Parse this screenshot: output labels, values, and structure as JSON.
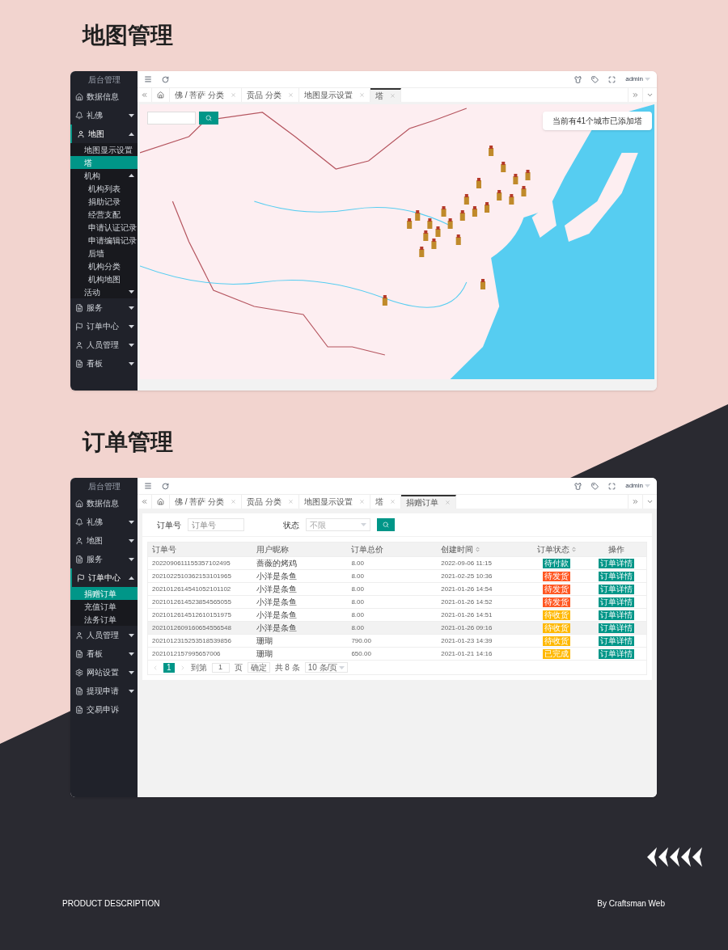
{
  "sections": [
    {
      "heading": "地图管理",
      "kind": "map",
      "window": {
        "brand": "后台管理",
        "user": "admin",
        "sidebar": [
          {
            "label": "数据信息"
          },
          {
            "label": "礼佛",
            "expanded": false
          },
          {
            "label": "地图",
            "expanded": true,
            "children": [
              {
                "label": "地图显示设置",
                "selected": false
              },
              {
                "label": "塔",
                "selected": true
              },
              {
                "label": "机构",
                "selected": false,
                "expanded": true,
                "children": [
                  {
                    "label": "机构列表",
                    "selected": false
                  },
                  {
                    "label": "捐助记录",
                    "selected": false
                  },
                  {
                    "label": "经营支配",
                    "selected": false
                  },
                  {
                    "label": "申请认证记录",
                    "selected": false
                  },
                  {
                    "label": "申请编辑记录",
                    "selected": false
                  },
                  {
                    "label": "后墙",
                    "selected": false
                  },
                  {
                    "label": "机构分类",
                    "selected": false
                  },
                  {
                    "label": "机构地图",
                    "selected": false
                  }
                ]
              },
              {
                "label": "活动",
                "selected": false,
                "expanded": false
              }
            ]
          },
          {
            "label": "服务",
            "expanded": false
          },
          {
            "label": "订单中心",
            "expanded": false
          },
          {
            "label": "人员管理",
            "expanded": false
          },
          {
            "label": "看板",
            "expanded": false
          }
        ],
        "tabs": [
          {
            "label": "佛 / 菩萨 分类",
            "selected": false
          },
          {
            "label": "贡品 分类",
            "selected": false
          },
          {
            "label": "地图显示设置",
            "selected": false
          },
          {
            "label": "塔",
            "selected": true
          }
        ]
      },
      "map_notice": "当前有41个城市已添加塔"
    },
    {
      "heading": "订单管理",
      "kind": "orders",
      "window": {
        "brand": "后台管理",
        "user": "admin",
        "sidebar": [
          {
            "label": "数据信息"
          },
          {
            "label": "礼佛",
            "expanded": false
          },
          {
            "label": "地图",
            "expanded": false
          },
          {
            "label": "服务",
            "expanded": false
          },
          {
            "label": "订单中心",
            "expanded": true,
            "children": [
              {
                "label": "捐赠订单",
                "selected": true
              },
              {
                "label": "充值订单",
                "selected": false
              },
              {
                "label": "法务订单",
                "selected": false
              }
            ]
          },
          {
            "label": "人员管理",
            "expanded": false
          },
          {
            "label": "看板",
            "expanded": false
          },
          {
            "label": "网站设置",
            "expanded": false
          },
          {
            "label": "提现申请",
            "expanded": false
          },
          {
            "label": "交易申诉"
          }
        ],
        "tabs": [
          {
            "label": "佛 / 菩萨 分类",
            "selected": false
          },
          {
            "label": "贡品 分类",
            "selected": false
          },
          {
            "label": "地图显示设置",
            "selected": false
          },
          {
            "label": "塔",
            "selected": false
          },
          {
            "label": "捐赠订单",
            "selected": true
          }
        ]
      },
      "filters": {
        "order_label": "订单号",
        "order_placeholder": "订单号",
        "status_label": "状态",
        "status_value": "不限"
      },
      "table": {
        "columns": [
          {
            "label": "订单号",
            "sortable": false
          },
          {
            "label": "用户昵称",
            "sortable": false
          },
          {
            "label": "订单总价",
            "sortable": false
          },
          {
            "label": "创建时间",
            "sortable": true
          },
          {
            "label": "订单状态",
            "sortable": true
          },
          {
            "label": "操作",
            "sortable": false
          }
        ],
        "rows": [
          {
            "order_no": "2022090611155357102495",
            "user": "蔷薇的烤鸡",
            "total": "8.00",
            "created": "2022-09-06 11:15",
            "status": "待付款",
            "color": "#009688",
            "action": "订单详情",
            "highlighted": false
          },
          {
            "order_no": "2021022510362153101965",
            "user": "小洋是条鱼",
            "total": "8.00",
            "created": "2021-02-25 10:36",
            "status": "待发货",
            "color": "#ff5722",
            "action": "订单详情",
            "highlighted": false
          },
          {
            "order_no": "2021012614541052101102",
            "user": "小洋是条鱼",
            "total": "8.00",
            "created": "2021-01-26 14:54",
            "status": "待发货",
            "color": "#ff5722",
            "action": "订单详情",
            "highlighted": false
          },
          {
            "order_no": "2021012614523854565055",
            "user": "小洋是条鱼",
            "total": "8.00",
            "created": "2021-01-26 14:52",
            "status": "待发货",
            "color": "#ff5722",
            "action": "订单详情",
            "highlighted": false
          },
          {
            "order_no": "2021012614512610151975",
            "user": "小洋是条鱼",
            "total": "8.00",
            "created": "2021-01-26 14:51",
            "status": "待收货",
            "color": "#ffb800",
            "action": "订单详情",
            "highlighted": false
          },
          {
            "order_no": "2021012609160654556548",
            "user": "小洋是条鱼",
            "total": "8.00",
            "created": "2021-01-26 09:16",
            "status": "待收货",
            "color": "#ffb800",
            "action": "订单详情",
            "highlighted": true
          },
          {
            "order_no": "2021012315253518539856",
            "user": "珊瑚",
            "total": "790.00",
            "created": "2021-01-23 14:39",
            "status": "待收货",
            "color": "#ffb800",
            "action": "订单详情",
            "highlighted": false
          },
          {
            "order_no": "2021012157995657006",
            "user": "珊瑚",
            "total": "650.00",
            "created": "2021-01-21 14:16",
            "status": "已完成",
            "color": "#ffb800",
            "action": "订单详情",
            "highlighted": false
          }
        ]
      },
      "pagination": {
        "pages": [
          {
            "label": "1",
            "selected": true
          }
        ],
        "goto_prefix": "到第",
        "goto_value": "1",
        "goto_suffix": "页",
        "confirm": "确定",
        "total": "共 8 条",
        "page_size": "10 条/页"
      }
    }
  ],
  "footer": {
    "left": "PRODUCT DESCRIPTION",
    "right": "By Craftsman Web"
  }
}
